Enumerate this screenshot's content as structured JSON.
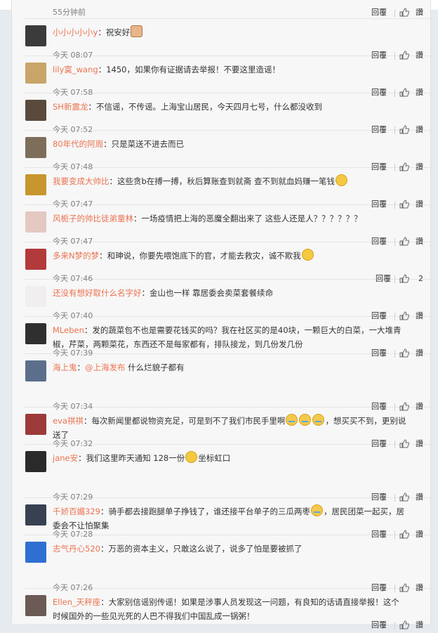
{
  "labels": {
    "reply": "回覆",
    "like": "讚"
  },
  "comments": [
    {
      "name": "",
      "text": "",
      "time": "55分钟前",
      "likes": "",
      "avatar_color": "#6c7a5a"
    },
    {
      "name": "小小小小小y",
      "text": "祝安好",
      "time": "今天 08:07",
      "likes": "",
      "avatar_color": "#3b3b3b",
      "emoji_end": "cat"
    },
    {
      "name": "lily寞_wang",
      "text": "1450，如果你有证据请去举报！不要这里造谣！",
      "time": "今天 07:58",
      "likes": "",
      "avatar_color": "#c9a56a"
    },
    {
      "name": "SH新震龙",
      "text": "不信谣，不传谣。上海宝山居民，今天四月七号，什么都没收到",
      "time": "今天 07:52",
      "likes": "",
      "avatar_color": "#5a4a3c"
    },
    {
      "name": "80年代的阿周",
      "text": "只是菜送不进去而已",
      "time": "今天 07:48",
      "likes": "",
      "avatar_color": "#7d6e5b"
    },
    {
      "name": "我要变成大帅比",
      "text": "这些贪b在搏一搏，秋后算账查到就斋 查不到就血妈赚一笔钱",
      "time": "今天 07:47",
      "likes": "",
      "avatar_color": "#c8962e",
      "emoji_end": "smile"
    },
    {
      "name": "风栀子的帅比徒弟童林",
      "text": "一场疫情把上海的恶魔全翻出来了 这些人还是人？？？？？？",
      "time": "今天 07:47",
      "likes": "",
      "avatar_color": "#e3c9c2"
    },
    {
      "name": "多来N梦的梦",
      "text": "和珅说，你要先喂饱底下的官，才能去救灾，诚不欺我",
      "time": "今天 07:46",
      "likes": "2",
      "avatar_color": "#b33a3a",
      "emoji_end": "smirk"
    },
    {
      "name": "还没有想好取什么名字好",
      "text": "金山也一样 靠居委会卖菜套餐续命",
      "time": "今天 07:40",
      "likes": "",
      "avatar_color": "#f0eeee"
    },
    {
      "name": "MLeben",
      "lines": [
        "发的蔬菜包不也是需要花钱买的吗？我在社区买的是40块，一颗巨大的白菜，一大堆青",
        "椒，芹菜，两颗菜花，东西还不是每家都有，排队接龙，到几份发几份"
      ],
      "time": "今天 07:39",
      "likes": "",
      "avatar_color": "#2f2f2f"
    },
    {
      "name": "海上鬼",
      "mention": "@上海发布",
      "text": "什么烂貌子都有",
      "time": "今天 07:34",
      "likes": "",
      "avatar_color": "#5b6f8c"
    },
    {
      "name": "eva祺祺",
      "lines": [
        "每次新闻里都说物资充足，可是到不了我们市民手里啊",
        "，想买买不到，更别说",
        "送了"
      ],
      "time": "今天 07:32",
      "likes": "",
      "avatar_color": "#9c3a3a"
    },
    {
      "name": "jane安",
      "text": "我们这里昨天通知 128一份",
      "text2": "坐标虹口",
      "time": "今天 07:29",
      "likes": "",
      "avatar_color": "#2a2a2a"
    },
    {
      "name": "千娇百媚329",
      "lines": [
        "骑手都去接跑腿单子挣钱了，谁还接平台单子的三瓜两枣",
        "，居民团菜一起买，居",
        "委会不让怕聚集"
      ],
      "time": "今天 07:28",
      "likes": "",
      "avatar_color": "#374152"
    },
    {
      "name": "志气丹心520",
      "text": "万恶的资本主义，只敢这么说了，说多了怕是要被抓了",
      "time": "今天 07:26",
      "likes": "",
      "avatar_color": "#2f6fd1"
    },
    {
      "name": "Ellen_天秤座",
      "lines": [
        "大家别信谣别传谣！如果是涉事人员发现这一问题，有良知的话请直接举报！这个",
        "时候国外的一些见光死的人巴不得我们中国乱成一锅粥！"
      ],
      "time": "",
      "likes": "",
      "avatar_color": "#6b5a56"
    }
  ]
}
